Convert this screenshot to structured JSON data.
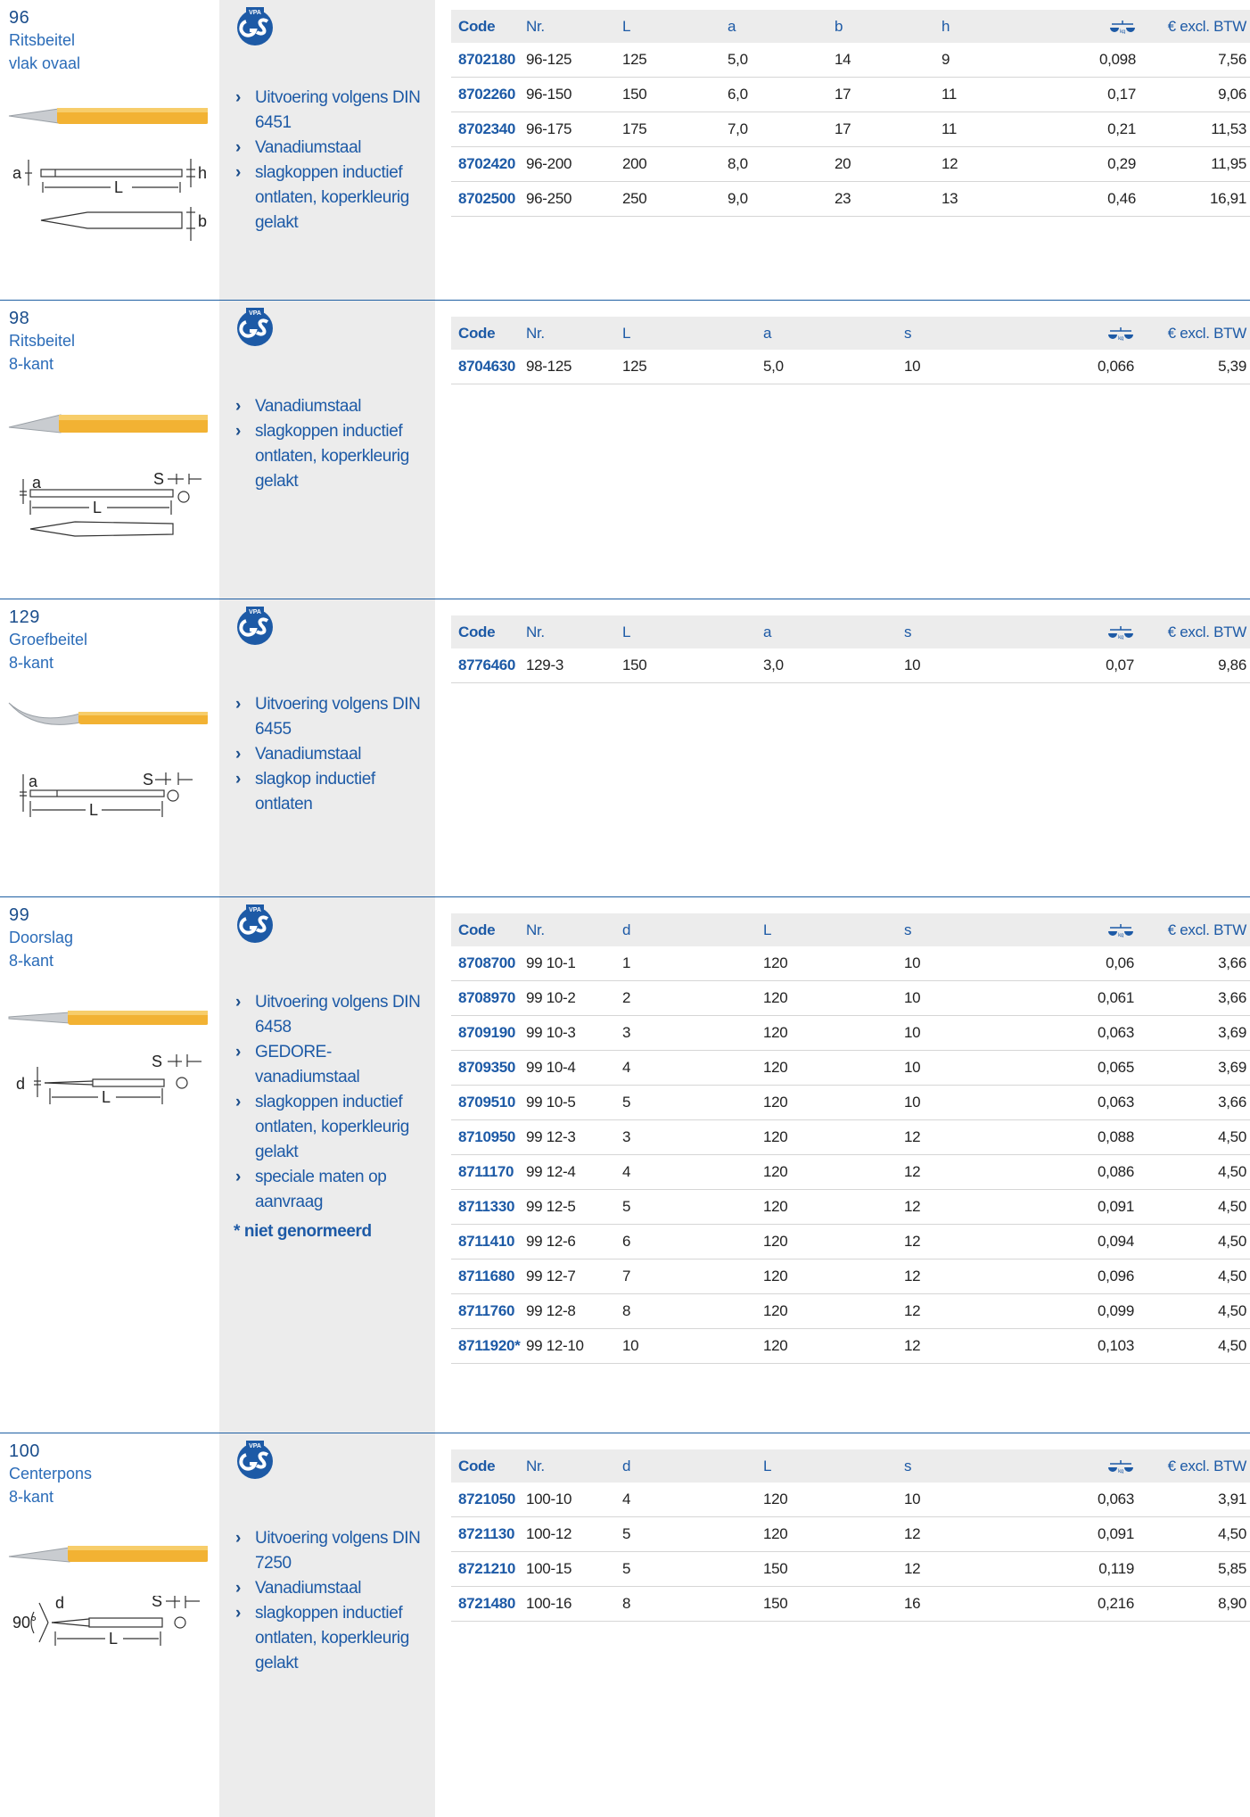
{
  "sections": [
    {
      "number": "96",
      "name_lines": [
        "Ritsbeitel",
        "vlak ovaal"
      ],
      "bullets": [
        "Uitvoering volgens DIN 6451",
        "Vanadiumstaal",
        "slagkoppen inductief ontlaten, koperkleurig gelakt"
      ],
      "note": "",
      "columns": [
        "Code",
        "Nr.",
        "L",
        "a",
        "b",
        "h",
        "kg-icon",
        "€ excl. BTW"
      ],
      "rows": [
        [
          "8702180",
          "96-125",
          "125",
          "5,0",
          "14",
          "9",
          "0,098",
          "7,56"
        ],
        [
          "8702260",
          "96-150",
          "150",
          "6,0",
          "17",
          "11",
          "0,17",
          "9,06"
        ],
        [
          "8702340",
          "96-175",
          "175",
          "7,0",
          "17",
          "11",
          "0,21",
          "11,53"
        ],
        [
          "8702420",
          "96-200",
          "200",
          "8,0",
          "20",
          "12",
          "0,29",
          "11,95"
        ],
        [
          "8702500",
          "96-250",
          "250",
          "9,0",
          "23",
          "13",
          "0,46",
          "16,91"
        ]
      ],
      "diagram_labels": [
        "a",
        "h",
        "L",
        "b"
      ]
    },
    {
      "number": "98",
      "name_lines": [
        "Ritsbeitel",
        "8-kant"
      ],
      "bullets": [
        "Vanadiumstaal",
        "slagkoppen inductief ontlaten, koperkleurig gelakt"
      ],
      "note": "",
      "columns": [
        "Code",
        "Nr.",
        "L",
        "a",
        "s",
        "kg-icon",
        "€ excl. BTW"
      ],
      "rows": [
        [
          "8704630",
          "98-125",
          "125",
          "5,0",
          "10",
          "0,066",
          "5,39"
        ]
      ],
      "diagram_labels": [
        "a",
        "S",
        "L"
      ]
    },
    {
      "number": "129",
      "name_lines": [
        "Groefbeitel",
        "8-kant"
      ],
      "bullets": [
        "Uitvoering volgens DIN 6455",
        "Vanadiumstaal",
        "slagkop inductief ontlaten"
      ],
      "note": "",
      "columns": [
        "Code",
        "Nr.",
        "L",
        "a",
        "s",
        "kg-icon",
        "€ excl. BTW"
      ],
      "rows": [
        [
          "8776460",
          "129-3",
          "150",
          "3,0",
          "10",
          "0,07",
          "9,86"
        ]
      ],
      "diagram_labels": [
        "a",
        "S",
        "L"
      ]
    },
    {
      "number": "99",
      "name_lines": [
        "Doorslag",
        "8-kant"
      ],
      "bullets": [
        "Uitvoering volgens DIN 6458",
        "GEDORE-vanadiumstaal",
        "slagkoppen inductief ontlaten, koperkleurig gelakt",
        "speciale maten op aanvraag"
      ],
      "note": "* niet genormeerd",
      "columns": [
        "Code",
        "Nr.",
        "d",
        "L",
        "s",
        "kg-icon",
        "€ excl. BTW"
      ],
      "rows": [
        [
          "8708700",
          "99 10-1",
          "1",
          "120",
          "10",
          "0,06",
          "3,66"
        ],
        [
          "8708970",
          "99 10-2",
          "2",
          "120",
          "10",
          "0,061",
          "3,66"
        ],
        [
          "8709190",
          "99 10-3",
          "3",
          "120",
          "10",
          "0,063",
          "3,69"
        ],
        [
          "8709350",
          "99 10-4",
          "4",
          "120",
          "10",
          "0,065",
          "3,69"
        ],
        [
          "8709510",
          "99 10-5",
          "5",
          "120",
          "10",
          "0,063",
          "3,66"
        ],
        [
          "8710950",
          "99 12-3",
          "3",
          "120",
          "12",
          "0,088",
          "4,50"
        ],
        [
          "8711170",
          "99 12-4",
          "4",
          "120",
          "12",
          "0,086",
          "4,50"
        ],
        [
          "8711330",
          "99 12-5",
          "5",
          "120",
          "12",
          "0,091",
          "4,50"
        ],
        [
          "8711410",
          "99 12-6",
          "6",
          "120",
          "12",
          "0,094",
          "4,50"
        ],
        [
          "8711680",
          "99 12-7",
          "7",
          "120",
          "12",
          "0,096",
          "4,50"
        ],
        [
          "8711760",
          "99 12-8",
          "8",
          "120",
          "12",
          "0,099",
          "4,50"
        ],
        [
          "8711920*",
          "99 12-10",
          "10",
          "120",
          "12",
          "0,103",
          "4,50"
        ]
      ],
      "diagram_labels": [
        "d",
        "S",
        "L"
      ]
    },
    {
      "number": "100",
      "name_lines": [
        "Centerpons",
        "8-kant"
      ],
      "bullets": [
        "Uitvoering volgens DIN 7250",
        "Vanadiumstaal",
        "slagkoppen inductief ontlaten, koperkleurig gelakt"
      ],
      "note": "",
      "columns": [
        "Code",
        "Nr.",
        "d",
        "L",
        "s",
        "kg-icon",
        "€ excl. BTW"
      ],
      "rows": [
        [
          "8721050",
          "100-10",
          "4",
          "120",
          "10",
          "0,063",
          "3,91"
        ],
        [
          "8721130",
          "100-12",
          "5",
          "120",
          "12",
          "0,091",
          "4,50"
        ],
        [
          "8721210",
          "100-15",
          "5",
          "150",
          "12",
          "0,119",
          "5,85"
        ],
        [
          "8721480",
          "100-16",
          "8",
          "150",
          "16",
          "0,216",
          "8,90"
        ]
      ],
      "diagram_labels": [
        "90°",
        "d",
        "S",
        "L"
      ]
    }
  ],
  "gs_logo_text": "VPA",
  "colors": {
    "accent": "#1d5aa6",
    "tool_body": "#f2b233",
    "grey_panel": "#ececec"
  }
}
